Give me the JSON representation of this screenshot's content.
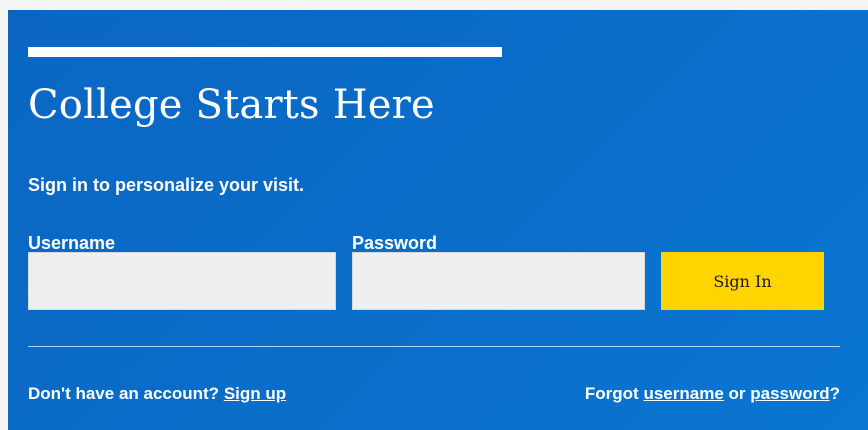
{
  "hero": {
    "title": "College Starts Here",
    "subtitle": "Sign in to personalize your visit."
  },
  "form": {
    "username_label": "Username",
    "username_value": "",
    "password_label": "Password",
    "password_value": "",
    "sign_in_label": "Sign In"
  },
  "footer": {
    "signup_prompt": "Don't have an account?",
    "signup_link": "Sign up",
    "forgot_prefix": "Forgot",
    "forgot_username_link": "username",
    "forgot_or": "or",
    "forgot_password_link": "password",
    "forgot_suffix": "?"
  },
  "colors": {
    "panel_blue": "#0a6ec9",
    "button_yellow": "#ffd400",
    "input_gray": "#efefef"
  }
}
